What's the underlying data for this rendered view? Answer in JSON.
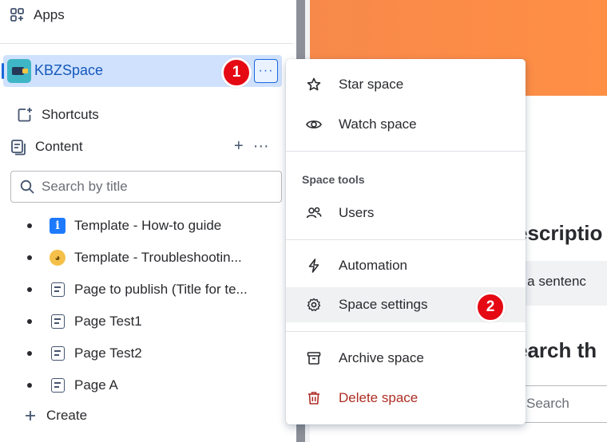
{
  "sidebar": {
    "apps_label": "Apps",
    "space": {
      "name": "KBZSpace",
      "more_label": "···"
    },
    "shortcuts_label": "Shortcuts",
    "content_label": "Content",
    "content_add": "+",
    "content_more": "···",
    "search": {
      "placeholder": "Search by title"
    },
    "tree": [
      {
        "label": "Template - How-to guide",
        "icon": "info-icon"
      },
      {
        "label": "Template - Troubleshootin...",
        "icon": "emoji-icon"
      },
      {
        "label": "Page to publish (Title for te...",
        "icon": "page-icon"
      },
      {
        "label": "Page Test1",
        "icon": "page-icon"
      },
      {
        "label": "Page Test2",
        "icon": "page-icon"
      },
      {
        "label": "Page A",
        "icon": "page-icon"
      }
    ],
    "create_label": "Create"
  },
  "menu": {
    "items": [
      {
        "label": "Star space",
        "icon": "star-icon"
      },
      {
        "label": "Watch space",
        "icon": "eye-icon"
      },
      {
        "label": "Users",
        "icon": "users-icon"
      },
      {
        "label": "Automation",
        "icon": "lightning-icon"
      },
      {
        "label": "Space settings",
        "icon": "gear-icon"
      },
      {
        "label": "Archive space",
        "icon": "archive-icon"
      },
      {
        "label": "Delete space",
        "icon": "trash-icon"
      }
    ],
    "section_label": "Space tools"
  },
  "main": {
    "heading_description": "escriptio",
    "quote_text": "n a sentenc",
    "heading_search": "earch th",
    "search_placeholder": "Search"
  },
  "annotations": {
    "badge_1": "1",
    "badge_2": "2"
  },
  "colors": {
    "accent": "#1868db",
    "badge": "#e50914",
    "danger": "#ae2e24",
    "selected_bg": "#cfe1fd"
  }
}
